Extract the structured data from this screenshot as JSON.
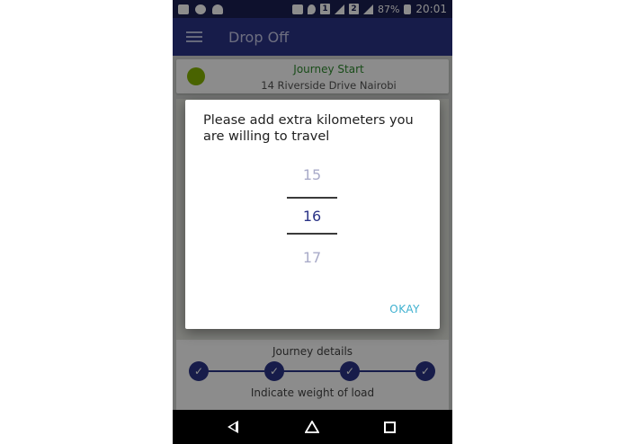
{
  "status_bar": {
    "sim1": "1",
    "sim2": "2",
    "battery": "87%",
    "time": "20:01"
  },
  "app_bar": {
    "title": "Drop Off"
  },
  "journey_start": {
    "title": "Journey Start",
    "address": "14 Riverside Drive Nairobi"
  },
  "bottom_card": {
    "details_label": "Journey details",
    "weight_label": "Indicate weight of load",
    "steps_completed": 4
  },
  "dialog": {
    "title": "Please add extra kilometers you are willing to travel",
    "picker": {
      "previous": "15",
      "selected": "16",
      "next": "17"
    },
    "okay_label": "OKAY"
  },
  "colors": {
    "primary": "#2b3487",
    "status_bar": "#1b1f52",
    "accent": "#3fb1d0",
    "start_dot": "#86b500",
    "start_title": "#2e8b2e"
  }
}
